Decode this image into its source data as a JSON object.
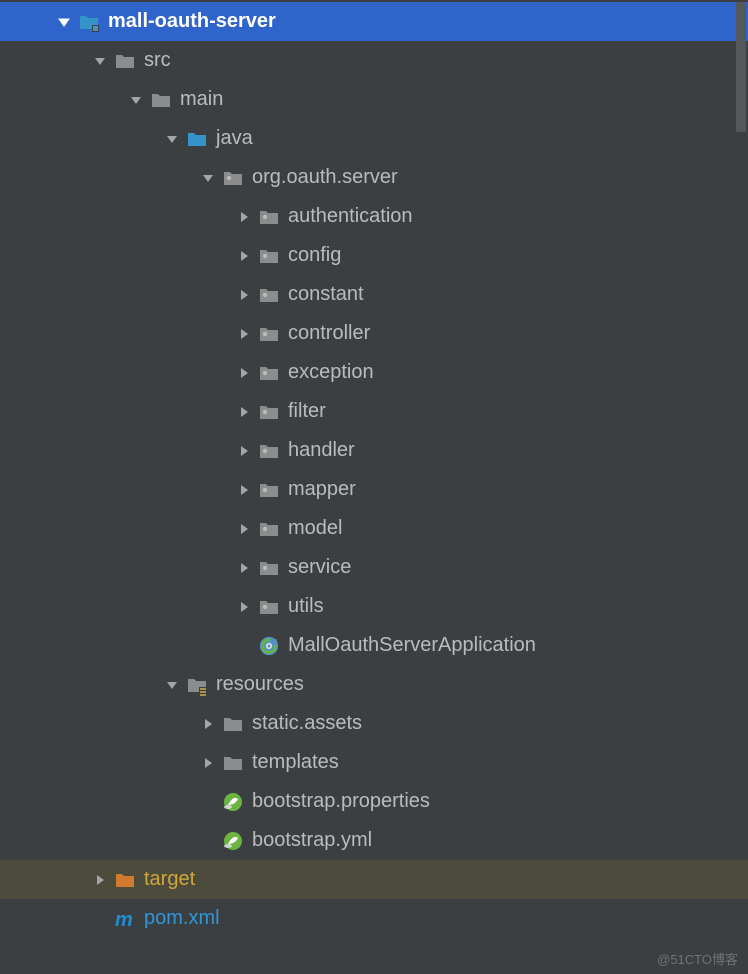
{
  "indentUnit": 36,
  "baseIndent": 54,
  "watermark": "@51CTO博客",
  "nodes": [
    {
      "depth": 0,
      "expand": "open",
      "icon": "module",
      "label": "mall-oauth-server",
      "bold": true,
      "selected": true
    },
    {
      "depth": 1,
      "expand": "open",
      "icon": "folder",
      "label": "src"
    },
    {
      "depth": 2,
      "expand": "open",
      "icon": "folder",
      "label": "main"
    },
    {
      "depth": 3,
      "expand": "open",
      "icon": "src-folder",
      "label": "java"
    },
    {
      "depth": 4,
      "expand": "open",
      "icon": "package",
      "label": "org.oauth.server"
    },
    {
      "depth": 5,
      "expand": "closed",
      "icon": "package",
      "label": "authentication"
    },
    {
      "depth": 5,
      "expand": "closed",
      "icon": "package",
      "label": "config"
    },
    {
      "depth": 5,
      "expand": "closed",
      "icon": "package",
      "label": "constant"
    },
    {
      "depth": 5,
      "expand": "closed",
      "icon": "package",
      "label": "controller"
    },
    {
      "depth": 5,
      "expand": "closed",
      "icon": "package",
      "label": "exception"
    },
    {
      "depth": 5,
      "expand": "closed",
      "icon": "package",
      "label": "filter"
    },
    {
      "depth": 5,
      "expand": "closed",
      "icon": "package",
      "label": "handler"
    },
    {
      "depth": 5,
      "expand": "closed",
      "icon": "package",
      "label": "mapper"
    },
    {
      "depth": 5,
      "expand": "closed",
      "icon": "package",
      "label": "model"
    },
    {
      "depth": 5,
      "expand": "closed",
      "icon": "package",
      "label": "service"
    },
    {
      "depth": 5,
      "expand": "closed",
      "icon": "package",
      "label": "utils"
    },
    {
      "depth": 5,
      "expand": "none",
      "icon": "spring-app",
      "label": "MallOauthServerApplication"
    },
    {
      "depth": 3,
      "expand": "open",
      "icon": "resources",
      "label": "resources"
    },
    {
      "depth": 4,
      "expand": "closed",
      "icon": "folder",
      "label": "static.assets"
    },
    {
      "depth": 4,
      "expand": "closed",
      "icon": "folder",
      "label": "templates"
    },
    {
      "depth": 4,
      "expand": "none",
      "icon": "spring-cfg",
      "label": "bootstrap.properties"
    },
    {
      "depth": 4,
      "expand": "none",
      "icon": "spring-cfg",
      "label": "bootstrap.yml"
    },
    {
      "depth": 1,
      "expand": "closed",
      "icon": "target",
      "label": "target",
      "targetColor": true,
      "highlight": true
    },
    {
      "depth": 1,
      "expand": "none",
      "icon": "maven",
      "label": "pom.xml",
      "blue": true
    }
  ]
}
